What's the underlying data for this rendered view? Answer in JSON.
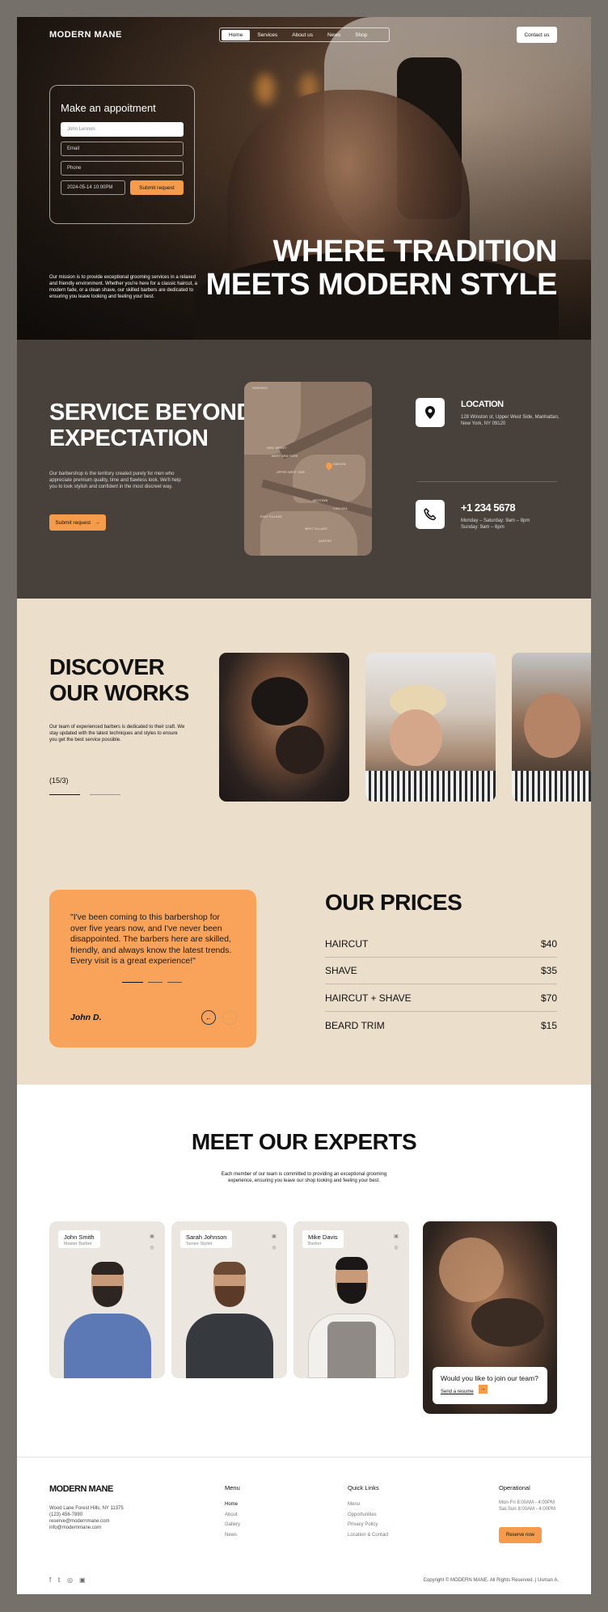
{
  "brand": {
    "logo": "MODERN MANE",
    "accent": "#f49c4b"
  },
  "nav": {
    "items": [
      "Home",
      "Services",
      "About us",
      "News",
      "Shop"
    ],
    "active": "Home",
    "contact": "Contact us"
  },
  "appointment": {
    "title": "Make an appoitment",
    "name_value": "John Lennon",
    "email_placeholder": "Email",
    "phone_placeholder": "Phone",
    "datetime_value": "2024-05-14  10:00PM",
    "submit": "Submit request"
  },
  "hero": {
    "mission": "Our mission is to provide exceptional grooming services in a relaxed and friendly environment. Whether you're here for a classic haircut, a modern fade, or a clean shave, our skilled barbers are dedicated to ensuring you leave looking and feeling your best.",
    "headline_1": "WHERE TRADITION",
    "headline_2": "MEETS MODERN STYLE"
  },
  "service": {
    "title_1": "SERVICE BEYOND",
    "title_2": "EXPECTATION",
    "desc": "Our barbershop is the territory created purely for men who appreciate premium quality, time and flawless look. We'll help you to look stylish and confident in the most discreet way.",
    "button": "Submit request",
    "location_title": "LOCATION",
    "location_text": "128 Winston st, Upper West Side, Manhattan, New York, NY 09120",
    "phone_title": "+1 234 5678",
    "phone_hours_1": "Monday – Saturday: 9am – 8pm",
    "phone_hours_2": "Sunday: 9am – 6pm",
    "map_labels": [
      "HOBOKEN",
      "NEW JERSEY",
      "WEST NEW YORK",
      "UPPER WEST SIDE",
      "HARLEM",
      "MIDTOWN",
      "CHELSEA",
      "EAST VILLAGE",
      "WEST VILLAGE",
      "QUEENS"
    ]
  },
  "works": {
    "title_1": "DISCOVER",
    "title_2": "OUR WORKS",
    "desc": "Our team of experienced barbers is dedicated to their craft. We stay updated with the latest techniques and styles to ensure you get the best service possible.",
    "counter": "(15/3)"
  },
  "testimonial": {
    "quote": "\"I've been coming to this barbershop for over five years now, and I've never been disappointed. The barbers here are skilled, friendly, and always know the latest trends. Every visit is a great experience!\"",
    "author": "John D."
  },
  "prices": {
    "title": "OUR PRICES",
    "items": [
      {
        "name": "HAIRCUT",
        "price": "$40"
      },
      {
        "name": "SHAVE",
        "price": "$35"
      },
      {
        "name": "HAIRCUT + SHAVE",
        "price": "$70"
      },
      {
        "name": "BEARD TRIM",
        "price": "$15"
      }
    ]
  },
  "experts": {
    "title": "MEET OUR EXPERTS",
    "desc": "Each member of our team is committed to providing an exceptional grooming experience, ensuring you leave our shop looking and feeling your best.",
    "people": [
      {
        "name": "John Smith",
        "role": "Master Barber"
      },
      {
        "name": "Sarah Johnson",
        "role": "Senior Stylist"
      },
      {
        "name": "Mike Davis",
        "role": "Barber"
      }
    ],
    "join_title": "Would you like to join our team?",
    "join_link": "Send a resume"
  },
  "footer": {
    "logo": "MODERN MANE",
    "address": [
      "Wood Lane Forest Hills, NY 11375",
      "(123) 456-7890",
      "reserve@modernmane.com",
      "info@modernmane.com"
    ],
    "menu_title": "Menu",
    "menu": [
      "Home",
      "About",
      "Gallery",
      "News"
    ],
    "quick_title": "Quick Links",
    "quick": [
      "Menu",
      "Opportunities",
      "Privacy Policy",
      "Location & Contact"
    ],
    "op_title": "Operational",
    "op": [
      "Mon-Fri 8:00AM - 4:00PM",
      "Sat-Sun 8:00AM - 4:00PM"
    ],
    "reserve": "Reserve now",
    "copyright": "Copyright © MODERN MANE. All Rights Reserved. | Usman A."
  }
}
